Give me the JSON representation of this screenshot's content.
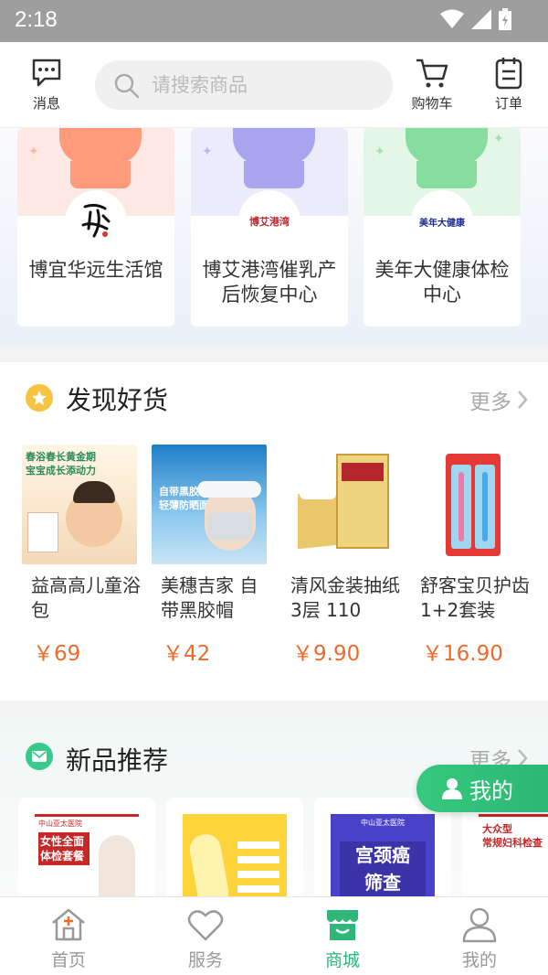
{
  "status_bar": {
    "time": "2:18"
  },
  "header": {
    "messages_label": "消息",
    "search_placeholder": "请搜索商品",
    "cart_label": "购物车",
    "orders_label": "订单"
  },
  "stores": [
    {
      "name": "博宜华远生活馆",
      "theme": "#ff9a7a",
      "band": "#fde8e3"
    },
    {
      "name": "博艾港湾催乳产后恢复中心",
      "logo_text": "博艾港湾",
      "theme": "#a9a6ef",
      "band": "#ecebfb"
    },
    {
      "name": "美年大健康体检中心",
      "logo_text": "美年大健康",
      "theme": "#86dd9e",
      "band": "#e3f6e8"
    }
  ],
  "discover": {
    "title": "发现好货",
    "more": "更多",
    "products": [
      {
        "name": "益高高儿童浴包",
        "price": "￥69",
        "poster_text": "春浴春长黄金期\n宝宝成长添动力"
      },
      {
        "name": "美穗吉家 自带黑胶帽",
        "price": "￥42",
        "poster_text": "自带黑胶\n轻薄防晒面"
      },
      {
        "name": "清风金装抽纸 3层 110",
        "price": "￥9.90"
      },
      {
        "name": "舒客宝贝护齿1+2套装",
        "price": "￥16.90"
      }
    ]
  },
  "new_products": {
    "title": "新品推荐",
    "more": "更多",
    "items": [
      {
        "poster_text": "女性全面\n体检套餐",
        "header": "中山亚太医院"
      },
      {
        "poster_text": ""
      },
      {
        "poster_text": "宫颈癌\n筛查",
        "header": "中山亚太医院"
      },
      {
        "poster_text": "大众型\n常规妇科检查"
      }
    ]
  },
  "fab": {
    "label": "我的"
  },
  "tabs": [
    {
      "label": "首页"
    },
    {
      "label": "服务"
    },
    {
      "label": "商城",
      "active": true
    },
    {
      "label": "我的"
    }
  ],
  "colors": {
    "accent": "#2fb779",
    "price": "#f06a2b"
  }
}
